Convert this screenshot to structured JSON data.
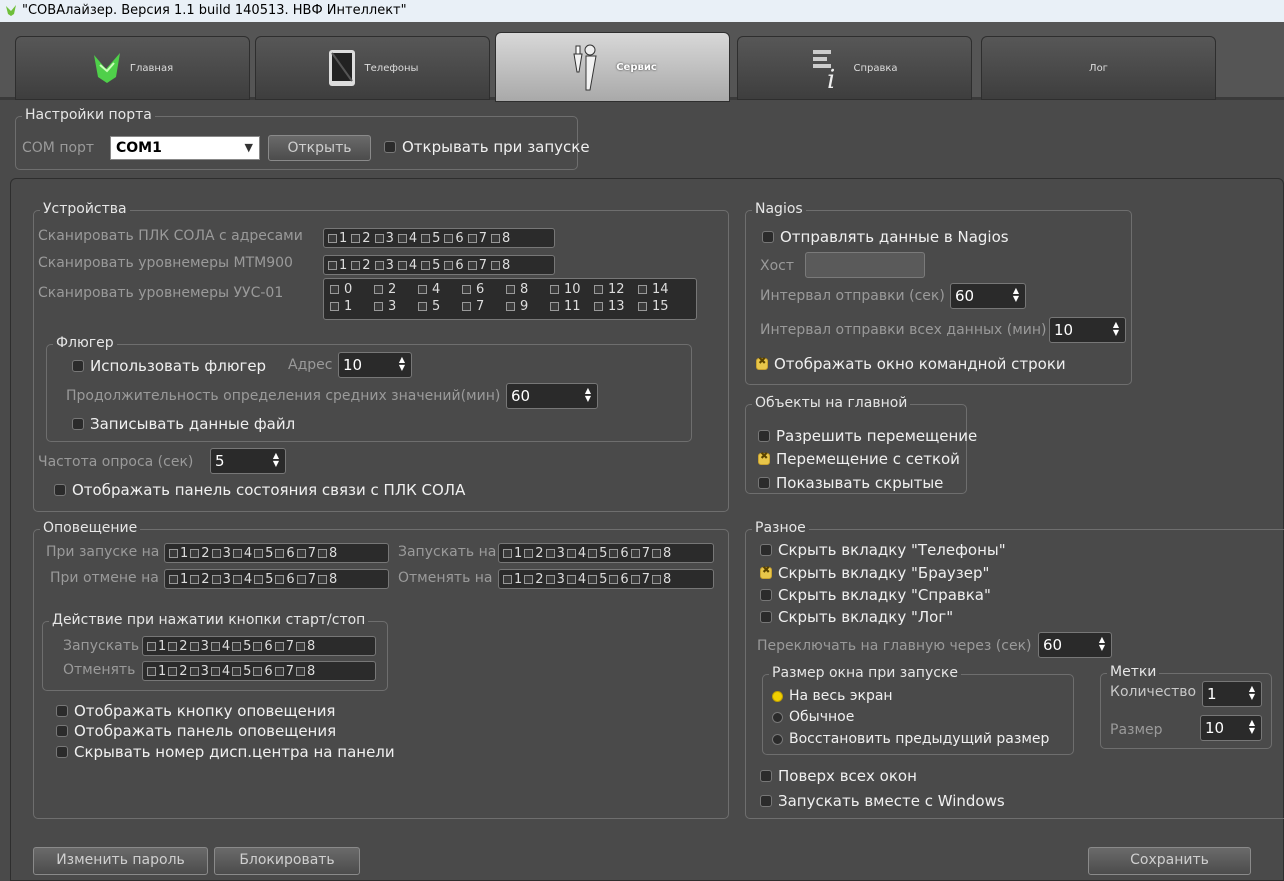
{
  "window": {
    "title": "\"СОВАлайзер. Версия 1.1 build 140513. НВФ Интеллект\""
  },
  "tabs": [
    {
      "label": "Главная",
      "icon": "owl-logo-icon"
    },
    {
      "label": "Телефоны",
      "icon": "tablet-icon"
    },
    {
      "label": "Сервис",
      "icon": "tools-icon"
    },
    {
      "label": "Справка",
      "icon": "help-book-icon"
    },
    {
      "label": "Лог",
      "icon": ""
    }
  ],
  "port": {
    "group_title": "Настройки порта",
    "com_label": "COM порт",
    "com_value": "COM1",
    "open_button": "Открыть",
    "open_on_start": "Открывать при запуске"
  },
  "devices": {
    "group_title": "Устройства",
    "scan_plc_label": "Сканировать ПЛК СОЛА с адресами",
    "scan_mtm_label": "Сканировать уровнемеры МТМ900",
    "scan_uus_label": "Сканировать уровнемеры УУС-01",
    "addr_1_8": [
      "1",
      "2",
      "3",
      "4",
      "5",
      "6",
      "7",
      "8"
    ],
    "addr_0_15_top": [
      "0",
      "2",
      "4",
      "6",
      "8",
      "10",
      "12",
      "14"
    ],
    "addr_0_15_bottom": [
      "1",
      "3",
      "5",
      "7",
      "9",
      "11",
      "13",
      "15"
    ],
    "vane": {
      "group_title": "Флюгер",
      "use_vane": "Использовать флюгер",
      "address_label": "Адрес",
      "address_value": "10",
      "duration_label": "Продолжительность определения средних значений(мин)",
      "duration_value": "60",
      "write_file": "Записывать данные файл"
    },
    "poll_label": "Частота опроса (сек)",
    "poll_value": "5",
    "show_status_panel": "Отображать панель состояния связи с ПЛК СОЛА"
  },
  "notify": {
    "group_title": "Оповещение",
    "on_start_label": "При запуске на",
    "run_on_label": "Запускать на",
    "on_cancel_label": "При отмене на",
    "cancel_on_label": "Отменять на",
    "action": {
      "group_title": "Действие при нажатии кнопки старт/стоп",
      "run_label": "Запускать",
      "cancel_label": "Отменять"
    },
    "show_button": "Отображать кнопку оповещения",
    "show_panel": "Отображать панель оповещения",
    "hide_number": "Скрывать номер дисп.центра на панели"
  },
  "nagios": {
    "group_title": "Nagios",
    "send_data": "Отправлять данные в Nagios",
    "host_label": "Хост",
    "interval_label": "Интервал отправки (сек)",
    "interval_value": "60",
    "interval_all_label": "Интервал отправки всех данных (мин)",
    "interval_all_value": "10",
    "show_console": "Отображать окно командной строки"
  },
  "objects": {
    "group_title": "Объекты на главной",
    "allow_move": "Разрешить перемещение",
    "grid_move": "Перемещение с сеткой",
    "show_hidden": "Показывать скрытые"
  },
  "misc": {
    "group_title": "Разное",
    "hide_phones": "Скрыть вкладку \"Телефоны\"",
    "hide_browser": "Скрыть вкладку \"Браузер\"",
    "hide_help": "Скрыть вкладку \"Справка\"",
    "hide_log": "Скрыть вкладку \"Лог\"",
    "switch_label": "Переключать на главную через (сек)",
    "switch_value": "60",
    "window_size": {
      "group_title": "Размер окна при запуске",
      "fullscreen": "На весь экран",
      "normal": "Обычное",
      "restore": "Восстановить предыдущий размер"
    },
    "marks": {
      "group_title": "Метки",
      "count_label": "Количество",
      "count_value": "1",
      "size_label": "Размер",
      "size_value": "10"
    },
    "on_top": "Поверх всех окон",
    "autostart": "Запускать вместе с Windows"
  },
  "footer": {
    "change_password": "Изменить пароль",
    "lock": "Блокировать",
    "save": "Сохранить"
  },
  "colors": {
    "checked": "#e8c64a",
    "radio_on": "#f0d000",
    "background": "#4a4a4a"
  }
}
